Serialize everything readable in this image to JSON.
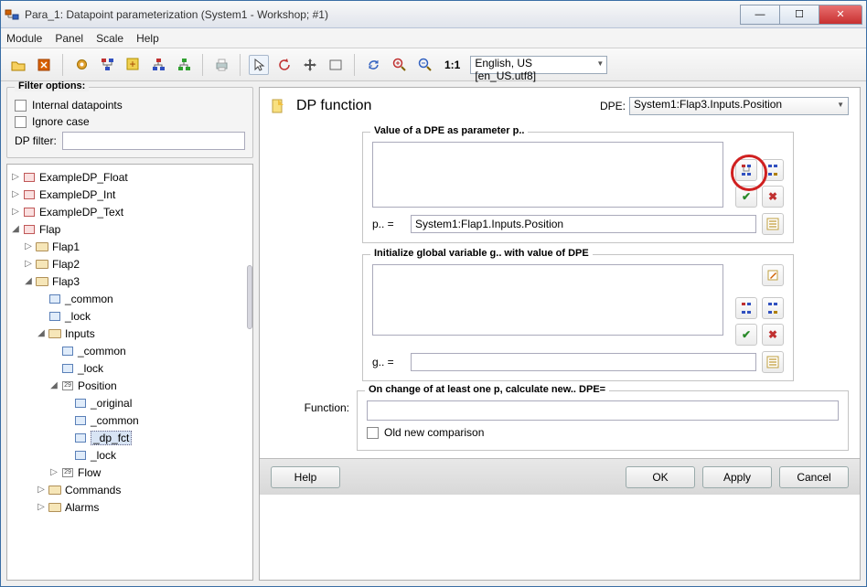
{
  "window": {
    "title": "Para_1: Datapoint parameterization (System1 - Workshop; #1)"
  },
  "menu": {
    "module": "Module",
    "panel": "Panel",
    "scale": "Scale",
    "help": "Help"
  },
  "toolbar": {
    "ratio": "1:1",
    "language": "English, US [en_US.utf8]"
  },
  "filter": {
    "legend": "Filter options:",
    "internal": "Internal datapoints",
    "ignorecase": "Ignore case",
    "dpfilter_label": "DP filter:",
    "dpfilter_value": ""
  },
  "tree": {
    "n0": "ExampleDP_Float",
    "n1": "ExampleDP_Int",
    "n2": "ExampleDP_Text",
    "n3": "Flap",
    "n3a": "Flap1",
    "n3b": "Flap2",
    "n3c": "Flap3",
    "n3c1": "_common",
    "n3c2": "_lock",
    "n3c3": "Inputs",
    "n3c3a": "_common",
    "n3c3b": "_lock",
    "n3c3c": "Position",
    "n3c3c1": "_original",
    "n3c3c2": "_common",
    "n3c3c3": "_dp_fct",
    "n3c3c4": "_lock",
    "n3c3d": "Flow",
    "n3d": "Commands",
    "n3e": "Alarms"
  },
  "main": {
    "heading": "DP function",
    "dpe_label": "DPE:",
    "dpe_value": "System1:Flap3.Inputs.Position",
    "g1_legend": "Value of a DPE as parameter p..",
    "g1_plabel": "p.. =",
    "g1_pvalue": "System1:Flap1.Inputs.Position",
    "g2_legend": "Initialize global variable g.. with value of DPE",
    "g2_glabel": "g.. =",
    "g2_gvalue": "",
    "g3_legend": "On change of at least one p, calculate new.. DPE=",
    "func_label": "Function:",
    "func_value": "",
    "oldnew": "Old new comparison"
  },
  "buttons": {
    "help": "Help",
    "ok": "OK",
    "apply": "Apply",
    "cancel": "Cancel"
  }
}
